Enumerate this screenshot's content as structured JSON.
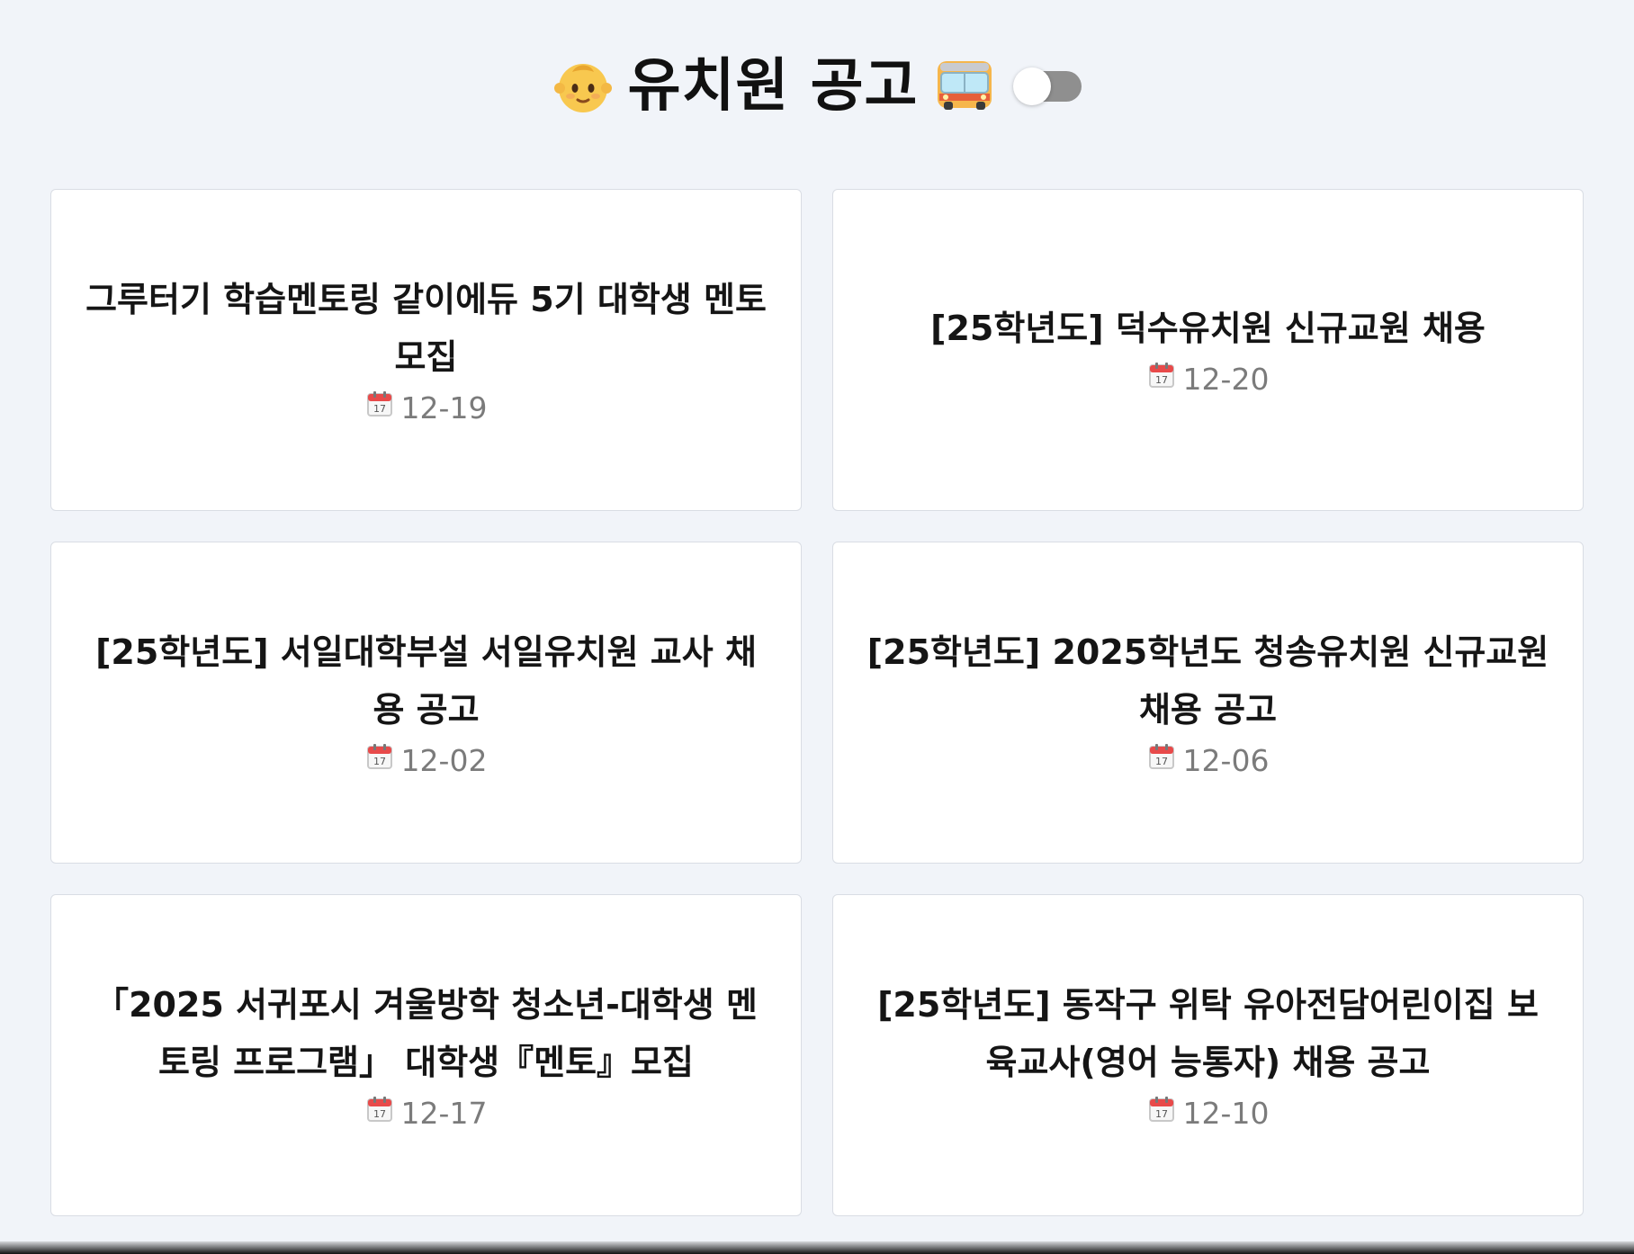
{
  "header": {
    "title": "유치원 공고",
    "left_icon": "baby-icon",
    "right_icon": "bus-icon",
    "toggle_state": "off"
  },
  "cards": [
    {
      "title": "그루터기 학습멘토링 같이에듀 5기 대학생 멘토 모집",
      "date": "12-19",
      "date_icon": "calendar-icon"
    },
    {
      "title": "[25학년도] 덕수유치원 신규교원 채용",
      "date": "12-20",
      "date_icon": "calendar-icon"
    },
    {
      "title": "[25학년도] 서일대학부설 서일유치원 교사 채용 공고",
      "date": "12-02",
      "date_icon": "calendar-icon"
    },
    {
      "title": "[25학년도] 2025학년도 청송유치원 신규교원 채용 공고",
      "date": "12-06",
      "date_icon": "calendar-icon"
    },
    {
      "title": "「2025 서귀포시 겨울방학 청소년-대학생 멘토링 프로그램」 대학생『멘토』모집",
      "date": "12-17",
      "date_icon": "calendar-icon"
    },
    {
      "title": "[25학년도] 동작구 위탁 유아전담어린이집 보육교사(영어 능통자) 채용 공고",
      "date": "12-10",
      "date_icon": "calendar-icon"
    }
  ],
  "colors": {
    "background": "#f1f4f9",
    "card_background": "#ffffff",
    "card_border": "#d9dde4",
    "date_text": "#7b7b7b",
    "toggle_off": "#8f8f8f"
  }
}
